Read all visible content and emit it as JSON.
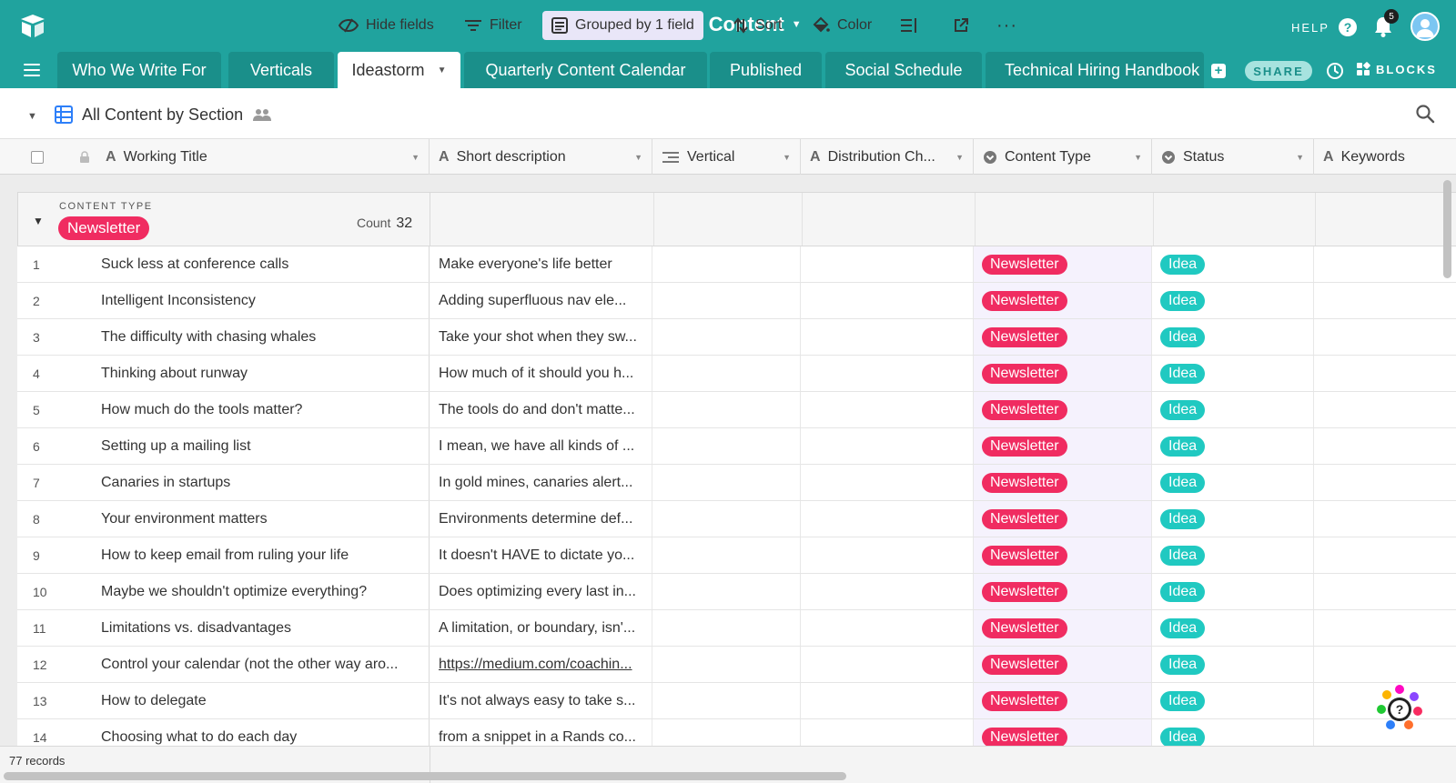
{
  "app": {
    "base_title": "Krit Content",
    "help_label": "HELP",
    "notification_count": "5",
    "share_label": "SHARE",
    "blocks_label": "BLOCKS"
  },
  "tabs": [
    {
      "label": "Who We Write For"
    },
    {
      "label": "Verticals"
    },
    {
      "label": "Ideastorm"
    },
    {
      "label": "Quarterly Content Calendar"
    },
    {
      "label": "Published"
    },
    {
      "label": "Social Schedule"
    },
    {
      "label": "Technical Hiring Handbook"
    }
  ],
  "toolbar": {
    "view_name": "All Content by Section",
    "hide_fields": "Hide fields",
    "filter": "Filter",
    "grouped": "Grouped by 1 field",
    "sort": "Sort",
    "color": "Color"
  },
  "columns": {
    "working_title": "Working Title",
    "short_description": "Short description",
    "vertical": "Vertical",
    "distribution": "Distribution Ch...",
    "content_type": "Content Type",
    "status": "Status",
    "keywords": "Keywords"
  },
  "group": {
    "label": "CONTENT TYPE",
    "value": "Newsletter",
    "count_label": "Count",
    "count": "32"
  },
  "rows": [
    {
      "num": "1",
      "title": "Suck less at conference calls",
      "desc": "Make everyone's life better",
      "ctype": "Newsletter",
      "status": "Idea"
    },
    {
      "num": "2",
      "title": "Intelligent Inconsistency",
      "desc": "Adding superfluous nav ele...",
      "ctype": "Newsletter",
      "status": "Idea"
    },
    {
      "num": "3",
      "title": "The difficulty with chasing whales",
      "desc": "Take your shot when they sw...",
      "ctype": "Newsletter",
      "status": "Idea"
    },
    {
      "num": "4",
      "title": "Thinking about runway",
      "desc": "How much of it should you h...",
      "ctype": "Newsletter",
      "status": "Idea"
    },
    {
      "num": "5",
      "title": "How much do the tools matter?",
      "desc": "The tools do and don't matte...",
      "ctype": "Newsletter",
      "status": "Idea"
    },
    {
      "num": "6",
      "title": "Setting up a mailing list",
      "desc": "I mean, we have all kinds of ...",
      "ctype": "Newsletter",
      "status": "Idea"
    },
    {
      "num": "7",
      "title": "Canaries in startups",
      "desc": "In gold mines, canaries alert...",
      "ctype": "Newsletter",
      "status": "Idea"
    },
    {
      "num": "8",
      "title": "Your environment matters",
      "desc": "Environments determine def...",
      "ctype": "Newsletter",
      "status": "Idea"
    },
    {
      "num": "9",
      "title": "How to keep email from ruling your life",
      "desc": "It doesn't HAVE to dictate yo...",
      "ctype": "Newsletter",
      "status": "Idea"
    },
    {
      "num": "10",
      "title": "Maybe we shouldn't optimize everything?",
      "desc": "Does optimizing every last in...",
      "ctype": "Newsletter",
      "status": "Idea"
    },
    {
      "num": "11",
      "title": "Limitations vs. disadvantages",
      "desc": "A limitation, or boundary, isn'...",
      "ctype": "Newsletter",
      "status": "Idea"
    },
    {
      "num": "12",
      "title": "Control your calendar (not the other way aro...",
      "desc": "https://medium.com/coachin...",
      "ctype": "Newsletter",
      "status": "Idea"
    },
    {
      "num": "13",
      "title": "How to delegate",
      "desc": "It's not always easy to take s...",
      "ctype": "Newsletter",
      "status": "Idea"
    },
    {
      "num": "14",
      "title": "Choosing what to do each day",
      "desc": "from a snippet in a Rands co...",
      "ctype": "Newsletter",
      "status": "Idea"
    }
  ],
  "footer": {
    "records": "77 records"
  },
  "colors": {
    "brand": "#20a39e",
    "newsletter": "#f02c61",
    "idea": "#20c9c1"
  }
}
